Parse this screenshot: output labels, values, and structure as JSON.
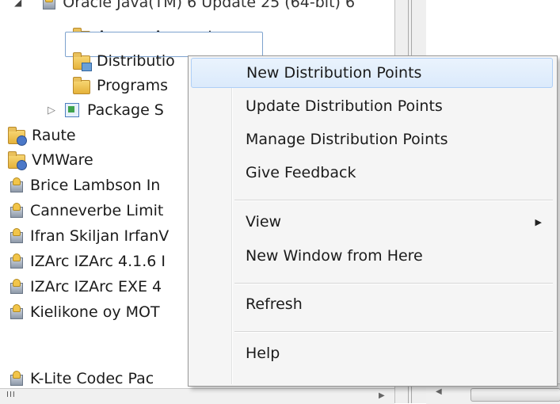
{
  "tree": {
    "top_cut_label": "Oracle Java(TM) 6 Update 25 (64-bit) 6",
    "children": [
      {
        "label": "Access Accounts",
        "icon": "user-folder-icon"
      },
      {
        "label": "Distribution Points",
        "visible_label": "Distributio",
        "icon": "distribution-folder-icon"
      },
      {
        "label": "Programs",
        "icon": "folder-icon"
      },
      {
        "label": "Package S",
        "icon": "package-source-icon"
      }
    ],
    "items": [
      {
        "label": "Raute",
        "icon": "user-folder-icon"
      },
      {
        "label": "VMWare",
        "icon": "user-folder-icon"
      },
      {
        "label": "Brice Lambson In",
        "icon": "package-icon"
      },
      {
        "label": "Canneverbe Limit",
        "icon": "package-icon"
      },
      {
        "label": "Ifran Skiljan IrfanV",
        "icon": "package-icon"
      },
      {
        "label": "IZArc IZArc 4.1.6 I",
        "icon": "package-icon"
      },
      {
        "label": "IZArc IZArc EXE 4",
        "icon": "package-icon"
      },
      {
        "label": "Kielikone oy MOT",
        "icon": "package-icon"
      },
      {
        "label": "K-Lite Codec Pac",
        "icon": "package-icon"
      }
    ]
  },
  "context_menu": {
    "items": [
      {
        "label": "New Distribution Points",
        "selected": true
      },
      {
        "label": "Update Distribution Points"
      },
      {
        "label": "Manage Distribution Points"
      },
      {
        "label": "Give Feedback"
      },
      {
        "label": "View",
        "submenu": true
      },
      {
        "label": "New Window from Here"
      },
      {
        "label": "Refresh"
      },
      {
        "label": "Help"
      }
    ],
    "highlight_color": "#dbeafb"
  },
  "scrollbar": {
    "grip": "III"
  }
}
